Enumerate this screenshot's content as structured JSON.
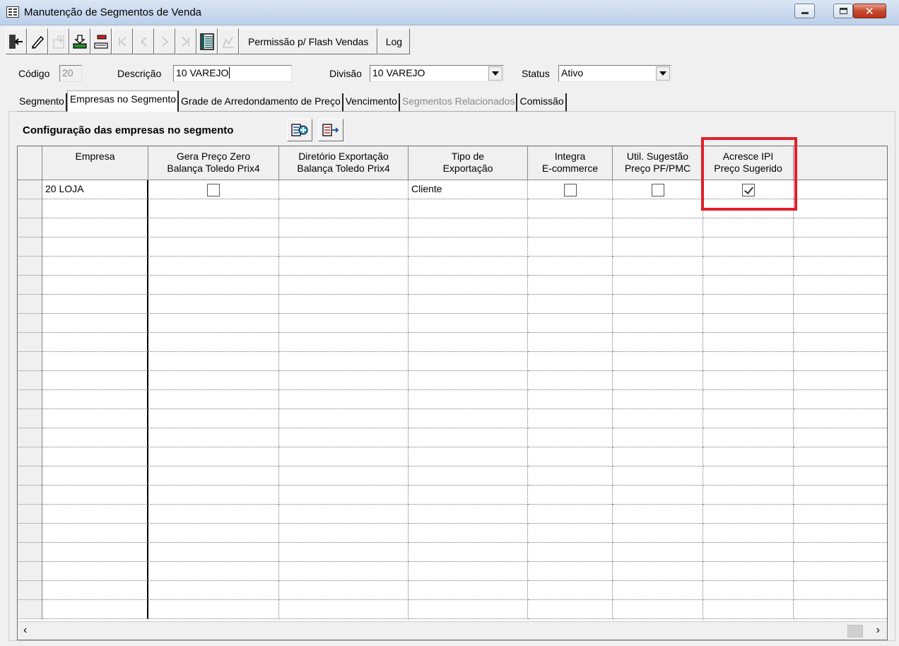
{
  "window": {
    "title": "Manutenção de Segmentos de Venda"
  },
  "toolbar": {
    "permission_label": "Permissão p/ Flash Vendas",
    "log_label": "Log"
  },
  "header": {
    "codigo_label": "Código",
    "codigo_value": "20",
    "descricao_label": "Descrição",
    "descricao_value": "10 VAREJO",
    "divisao_label": "Divisão",
    "divisao_value": "10 VAREJO",
    "status_label": "Status",
    "status_value": "Ativo"
  },
  "tabs": [
    {
      "label": "Segmento",
      "active": false,
      "disabled": false
    },
    {
      "label": "Empresas no Segmento",
      "active": true,
      "disabled": false
    },
    {
      "label": "Grade de Arredondamento de Preço",
      "active": false,
      "disabled": false
    },
    {
      "label": "Vencimento",
      "active": false,
      "disabled": false
    },
    {
      "label": "Segmentos Relacionados",
      "active": false,
      "disabled": true
    },
    {
      "label": "Comissão",
      "active": false,
      "disabled": false
    }
  ],
  "section": {
    "title": "Configuração das empresas no segmento"
  },
  "grid": {
    "columns": [
      {
        "line1": "Empresa",
        "line2": ""
      },
      {
        "line1": "Gera Preço Zero",
        "line2": "Balança Toledo Prix4"
      },
      {
        "line1": "Diretório Exportação",
        "line2": "Balança Toledo Prix4"
      },
      {
        "line1": "Tipo de",
        "line2": "Exportação"
      },
      {
        "line1": "Integra",
        "line2": "E-commerce"
      },
      {
        "line1": "Util. Sugestão",
        "line2": "Preço PF/PMC"
      },
      {
        "line1": "Acresce IPI",
        "line2": "Preço Sugerido"
      }
    ],
    "rows": [
      {
        "empresa": "20 LOJA",
        "gera_preco_zero": false,
        "diretorio": "",
        "tipo_exportacao": "Cliente",
        "integra_ecommerce": false,
        "util_sugestao": false,
        "acresce_ipi": true
      }
    ]
  },
  "colors": {
    "highlight": "#e0202a"
  }
}
